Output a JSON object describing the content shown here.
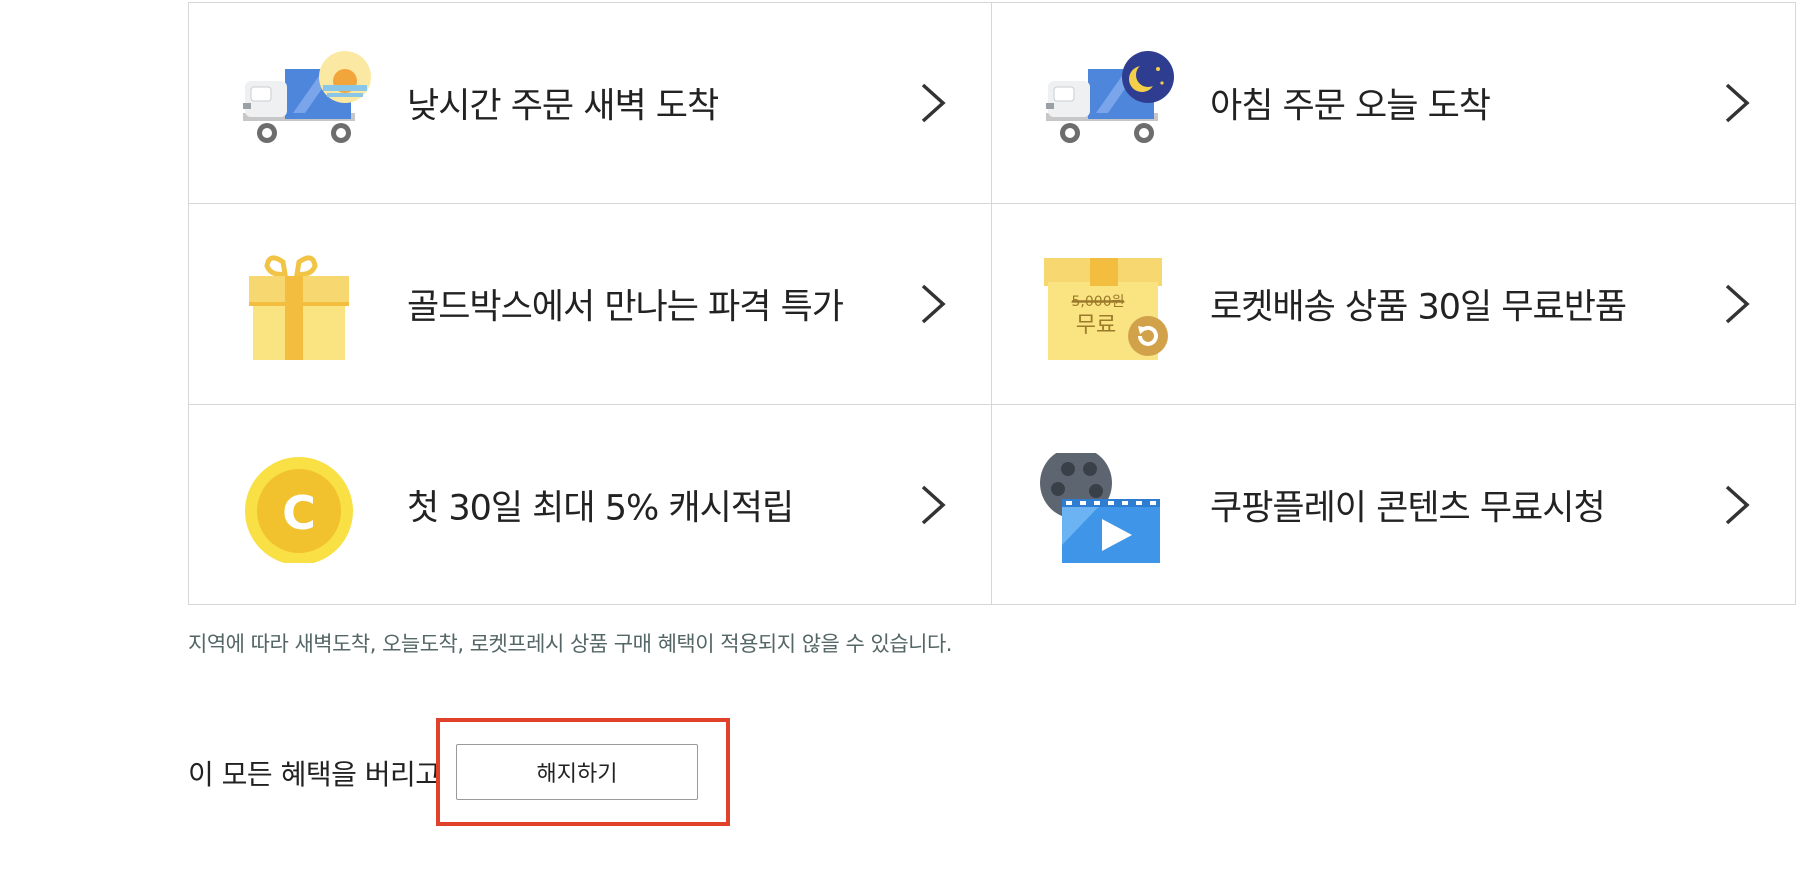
{
  "benefits": [
    {
      "label": "낮시간 주문 새벽 도착",
      "icon": "truck-sun-icon"
    },
    {
      "label": "아침 주문 오늘 도착",
      "icon": "truck-moon-icon"
    },
    {
      "label": "골드박스에서 만나는 파격 특가",
      "icon": "gift-box-icon"
    },
    {
      "label": "로켓배송 상품 30일 무료반품",
      "icon": "return-box-icon",
      "box_price": "5,000원",
      "box_free": "무료"
    },
    {
      "label": "첫 30일 최대 5% 캐시적립",
      "icon": "coin-icon",
      "coin_letter": "C"
    },
    {
      "label": "쿠팡플레이 콘텐츠 무료시청",
      "icon": "play-video-icon"
    }
  ],
  "notice": "지역에 따라 새벽도착, 오늘도착, 로켓프레시 상품 구매 혜택이 적용되지 않을 수 있습니다.",
  "cancel": {
    "prompt": "이 모든 혜택을 버리고",
    "button_label": "해지하기"
  },
  "colors": {
    "highlight_border": "#e0412a",
    "coin_yellow": "#f6cf2b",
    "truck_blue": "#4e86dc"
  }
}
